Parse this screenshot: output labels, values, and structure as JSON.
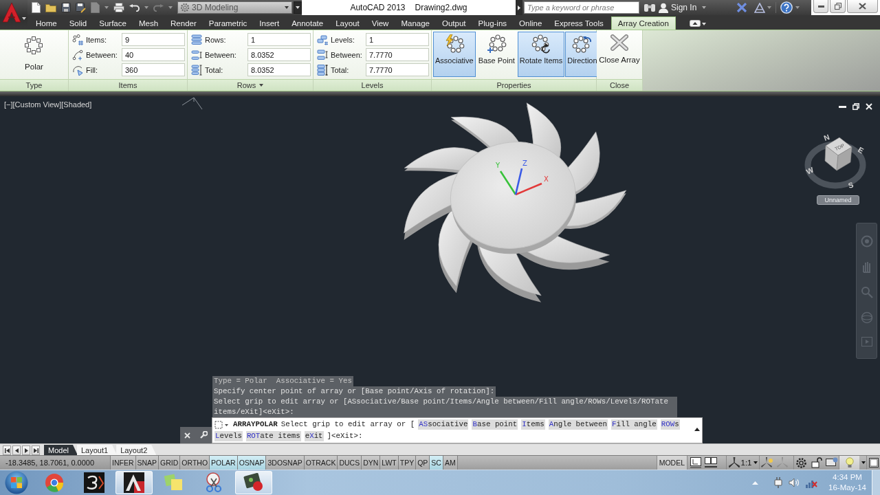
{
  "title_bar": {
    "workspace": "3D Modeling",
    "app_title": "AutoCAD 2013",
    "file_name": "Drawing2.dwg",
    "search": {
      "placeholder": "Type a keyword or phrase"
    },
    "sign_in": "Sign In"
  },
  "ribbon_tabs": [
    {
      "label": "Home",
      "selected": false
    },
    {
      "label": "Solid",
      "selected": false
    },
    {
      "label": "Surface",
      "selected": false
    },
    {
      "label": "Mesh",
      "selected": false
    },
    {
      "label": "Render",
      "selected": false
    },
    {
      "label": "Parametric",
      "selected": false
    },
    {
      "label": "Insert",
      "selected": false
    },
    {
      "label": "Annotate",
      "selected": false
    },
    {
      "label": "Layout",
      "selected": false
    },
    {
      "label": "View",
      "selected": false
    },
    {
      "label": "Manage",
      "selected": false
    },
    {
      "label": "Output",
      "selected": false
    },
    {
      "label": "Plug-ins",
      "selected": false
    },
    {
      "label": "Online",
      "selected": false
    },
    {
      "label": "Express Tools",
      "selected": false
    },
    {
      "label": "Array Creation",
      "selected": true
    }
  ],
  "ribbon": {
    "panels": [
      {
        "kind": "type",
        "title": "Type",
        "has_menu": false,
        "button": "Polar"
      },
      {
        "kind": "fields",
        "title": "Items",
        "has_menu": false,
        "fields": [
          {
            "label": "Items:",
            "value": "9"
          },
          {
            "label": "Between:",
            "value": "40"
          },
          {
            "label": "Fill:",
            "value": "360"
          }
        ]
      },
      {
        "kind": "fields",
        "title": "Rows",
        "has_menu": true,
        "fields": [
          {
            "label": "Rows:",
            "value": "1"
          },
          {
            "label": "Between:",
            "value": "8.0352"
          },
          {
            "label": "Total:",
            "value": "8.0352"
          }
        ]
      },
      {
        "kind": "fields",
        "title": "Levels",
        "has_menu": false,
        "fields": [
          {
            "label": "Levels:",
            "value": "1"
          },
          {
            "label": "Between:",
            "value": "7.7770"
          },
          {
            "label": "Total:",
            "value": "7.7770"
          }
        ]
      },
      {
        "kind": "toggles",
        "title": "Properties",
        "has_menu": false,
        "buttons": [
          {
            "label": "Associative",
            "selected": true
          },
          {
            "label": "Base Point",
            "selected": false
          },
          {
            "label": "Rotate Items",
            "selected": true
          },
          {
            "label": "Direction",
            "selected": true
          }
        ]
      },
      {
        "kind": "close",
        "title": "Close",
        "has_menu": false,
        "button": "Close Array"
      }
    ]
  },
  "viewport": {
    "label": "[−][Custom View][Shaded]",
    "axis_labels": [
      "X",
      "Y",
      "Z"
    ],
    "view_cube": {
      "face": "TOP",
      "compass": [
        "N",
        "E",
        "S",
        "W"
      ]
    },
    "ucs_menu": "Unnamed"
  },
  "command_line": {
    "history": [
      "Type = Polar  Associative = Yes",
      "Specify center point of array or [Base point/Axis of rotation]:",
      "Select grip to edit array or [ASsociative/Base point/Items/Angle between/Fill angle/ROWs/Levels/ROTate items/eXit]<eXit>:"
    ],
    "command": "ARRAYPOLAR",
    "prompt": "Select grip to edit array or [",
    "options": [
      {
        "key": "AS",
        "rest": "sociative"
      },
      {
        "key": "B",
        "rest": "ase point"
      },
      {
        "key": "I",
        "rest": "tems"
      },
      {
        "key": "A",
        "rest": "ngle between"
      },
      {
        "key": "F",
        "rest": "ill angle"
      },
      {
        "key": "ROW",
        "rest": "s"
      },
      {
        "key": "L",
        "rest": "evels"
      },
      {
        "key": "ROT",
        "rest": "ate items"
      },
      {
        "lead": "e",
        "key": "X",
        "rest": "it"
      }
    ],
    "suffix": "]<eXit>:"
  },
  "layout_tabs": [
    {
      "label": "Model",
      "selected": true
    },
    {
      "label": "Layout1",
      "selected": false
    },
    {
      "label": "Layout2",
      "selected": false
    }
  ],
  "status_bar": {
    "coordinates": "-18.3485, 18.7061, 0.0000",
    "toggles": [
      {
        "label": "INFER",
        "on": false
      },
      {
        "label": "SNAP",
        "on": false
      },
      {
        "label": "GRID",
        "on": false
      },
      {
        "label": "ORTHO",
        "on": false
      },
      {
        "label": "POLAR",
        "on": true
      },
      {
        "label": "OSNAP",
        "on": true
      },
      {
        "label": "3DOSNAP",
        "on": false
      },
      {
        "label": "OTRACK",
        "on": false
      },
      {
        "label": "DUCS",
        "on": false
      },
      {
        "label": "DYN",
        "on": false
      },
      {
        "label": "LWT",
        "on": false
      },
      {
        "label": "TPY",
        "on": false
      },
      {
        "label": "QP",
        "on": false
      },
      {
        "label": "SC",
        "on": true
      },
      {
        "label": "AM",
        "on": false
      }
    ],
    "space": "MODEL",
    "annotation_scale": "1:1"
  },
  "taskbar": {
    "apps": [
      {
        "active": false
      },
      {
        "active": false
      },
      {
        "active": true
      },
      {
        "active": false
      },
      {
        "active": false
      },
      {
        "active": true
      }
    ],
    "time": "4:34 PM",
    "date": "16-May-14"
  }
}
